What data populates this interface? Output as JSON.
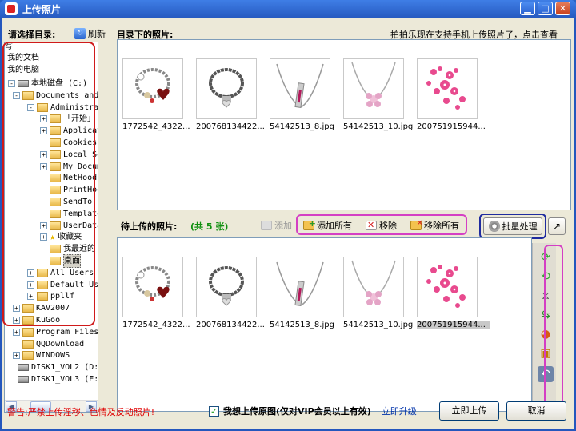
{
  "window": {
    "title": "上传照片"
  },
  "sidebar": {
    "label": "请选择目录:",
    "refresh_label": "刷新",
    "top_items": [
      "我的文档",
      "我的电脑"
    ],
    "first_char": "写",
    "tree": [
      {
        "label": "本地磁盘 (C:)",
        "level": 0,
        "type": "drive",
        "exp": "-"
      },
      {
        "label": "Documents and S",
        "level": 1,
        "type": "folder",
        "exp": "-"
      },
      {
        "label": "Administrat",
        "level": 2,
        "type": "folder",
        "exp": "-"
      },
      {
        "label": "「开始」",
        "level": 3,
        "type": "folder",
        "exp": "+"
      },
      {
        "label": "Applicat",
        "level": 3,
        "type": "folder",
        "exp": "+"
      },
      {
        "label": "Cookies",
        "level": 3,
        "type": "folder",
        "exp": ""
      },
      {
        "label": "Local Se",
        "level": 3,
        "type": "folder",
        "exp": "+"
      },
      {
        "label": "My Docum",
        "level": 3,
        "type": "folder",
        "exp": "+"
      },
      {
        "label": "NetHood",
        "level": 3,
        "type": "folder",
        "exp": ""
      },
      {
        "label": "PrintHoo",
        "level": 3,
        "type": "folder",
        "exp": ""
      },
      {
        "label": "SendTo",
        "level": 3,
        "type": "folder",
        "exp": ""
      },
      {
        "label": "Template",
        "level": 3,
        "type": "folder",
        "exp": ""
      },
      {
        "label": "UserData",
        "level": 3,
        "type": "folder",
        "exp": "+"
      },
      {
        "label": "收藏夹",
        "level": 3,
        "type": "star",
        "exp": "+"
      },
      {
        "label": "我最近的",
        "level": 3,
        "type": "folder",
        "exp": ""
      },
      {
        "label": "桌面",
        "level": 3,
        "type": "folder",
        "exp": ""
      },
      {
        "label": "All Users",
        "level": 2,
        "type": "folder",
        "exp": "+"
      },
      {
        "label": "Default User",
        "level": 2,
        "type": "folder",
        "exp": "+"
      },
      {
        "label": "ppllf",
        "level": 2,
        "type": "folder",
        "exp": "+"
      },
      {
        "label": "KAV2007",
        "level": 1,
        "type": "folder",
        "exp": "+"
      },
      {
        "label": "KuGoo",
        "level": 1,
        "type": "folder",
        "exp": "+"
      },
      {
        "label": "Program Files",
        "level": 1,
        "type": "folder",
        "exp": "+"
      },
      {
        "label": "QQDownload",
        "level": 1,
        "type": "folder",
        "exp": ""
      },
      {
        "label": "WINDOWS",
        "level": 1,
        "type": "folder",
        "exp": "+"
      },
      {
        "label": "DISK1_VOL2 (D:)",
        "level": 0,
        "type": "drive",
        "exp": ""
      },
      {
        "label": "DISK1_VOL3 (E:)",
        "level": 0,
        "type": "drive",
        "exp": ""
      }
    ]
  },
  "top_panel": {
    "label": "目录下的照片:",
    "hint": "拍拍乐现在支持手机上传照片了，点击查看",
    "photos": [
      {
        "name": "1772542_4322...",
        "kind": "heart-bracelet"
      },
      {
        "name": "200768134422...",
        "kind": "charm-bracelet"
      },
      {
        "name": "54142513_8.jpg",
        "kind": "bar-necklace"
      },
      {
        "name": "54142513_10.jpg",
        "kind": "flower-necklace"
      },
      {
        "name": "200751915944...",
        "kind": "pink-flowers"
      }
    ]
  },
  "middle": {
    "label_prefix": "待上传的照片:",
    "count_label": "(共 5 张)",
    "add_label": "添加",
    "add_all_label": "添加所有",
    "remove_label": "移除",
    "remove_all_label": "移除所有",
    "batch_label": "批量处理"
  },
  "bottom_panel": {
    "photos": [
      {
        "name": "1772542_4322...",
        "kind": "heart-bracelet"
      },
      {
        "name": "200768134422...",
        "kind": "charm-bracelet"
      },
      {
        "name": "54142513_8.jpg",
        "kind": "bar-necklace"
      },
      {
        "name": "54142513_10.jpg",
        "kind": "flower-necklace"
      },
      {
        "name": "200751915944...",
        "kind": "pink-flowers",
        "selected": true
      }
    ]
  },
  "footer": {
    "warning": "警告:严禁上传淫秽、色情及反动照片!",
    "checkbox_label": "我想上传原图(仅对VIP会员以上有效)",
    "upgrade_label": "立即升级",
    "upload_label": "立即上传",
    "cancel_label": "取消"
  },
  "colors": {
    "accent_pink": "#d43fc4",
    "accent_blue": "#1f2b9f",
    "accent_red": "#d01a1a"
  }
}
